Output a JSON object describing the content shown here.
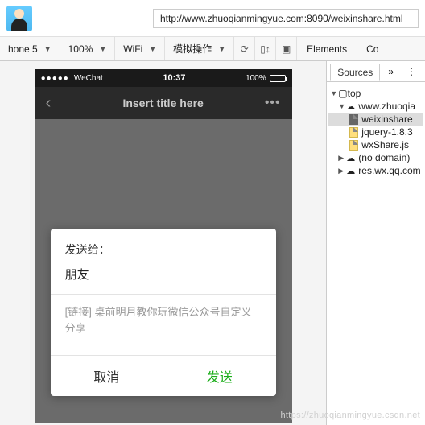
{
  "browser": {
    "url": "http://www.zhuoqianmingyue.com:8090/weixinshare.html"
  },
  "device_toolbar": {
    "device": "hone 5",
    "zoom": "100%",
    "network": "WiFi",
    "throttle": "模拟操作"
  },
  "devtools": {
    "main_tabs": {
      "elements": "Elements",
      "console_short": "Co"
    },
    "sub_tab_active": "Sources",
    "tree": {
      "top": "top",
      "domain": "www.zhuoqia",
      "files": {
        "html": "weixinshare",
        "jquery": "jquery-1.8.3",
        "wxshare": "wxShare.js"
      },
      "nodomain": "(no domain)",
      "reswx": "res.wx.qq.com"
    }
  },
  "phone": {
    "status": {
      "carrier": "WeChat",
      "time": "10:37",
      "battery": "100%"
    },
    "nav": {
      "title": "Insert title here"
    },
    "dialog": {
      "send_to_label": "发送给：",
      "recipient": "朋友",
      "link_text": "[链接] 桌前明月教你玩微信公众号自定义分享",
      "cancel": "取消",
      "send": "发送"
    }
  },
  "watermark": "https://zhuoqianmingyue.csdn.net"
}
